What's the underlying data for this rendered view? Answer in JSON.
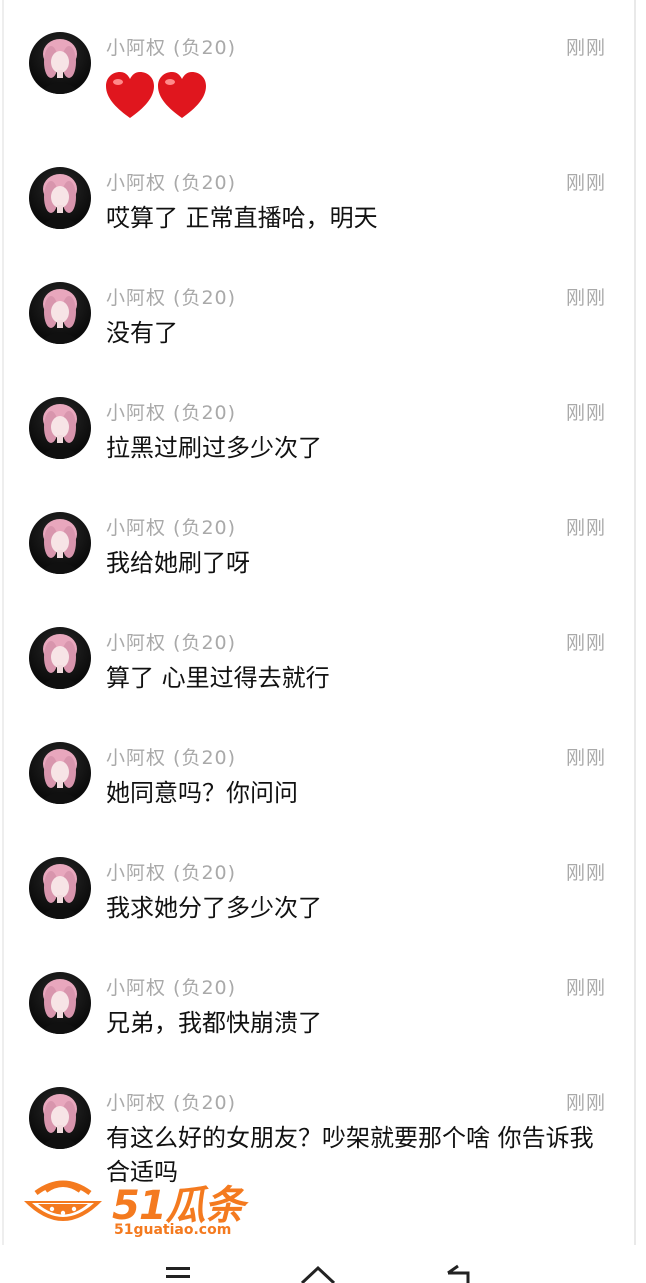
{
  "chat": {
    "messages": [
      {
        "sender": "小阿权 (负20)",
        "time": "刚刚",
        "text": "",
        "type": "hearts"
      },
      {
        "sender": "小阿权 (负20)",
        "time": "刚刚",
        "text": "哎算了 正常直播哈，明天"
      },
      {
        "sender": "小阿权 (负20)",
        "time": "刚刚",
        "text": "没有了"
      },
      {
        "sender": "小阿权 (负20)",
        "time": "刚刚",
        "text": "拉黑过刷过多少次了"
      },
      {
        "sender": "小阿权 (负20)",
        "time": "刚刚",
        "text": "我给她刷了呀"
      },
      {
        "sender": "小阿权 (负20)",
        "time": "刚刚",
        "text": "算了 心里过得去就行"
      },
      {
        "sender": "小阿权 (负20)",
        "time": "刚刚",
        "text": "她同意吗？你问问"
      },
      {
        "sender": "小阿权 (负20)",
        "time": "刚刚",
        "text": "我求她分了多少次了"
      },
      {
        "sender": "小阿权 (负20)",
        "time": "刚刚",
        "text": "兄弟，我都快崩溃了"
      },
      {
        "sender": "小阿权 (负20)",
        "time": "刚刚",
        "text": "有这么好的女朋友？吵架就要那个啥 你告诉我合适吗"
      }
    ]
  },
  "watermark": {
    "brand": "51瓜条",
    "url": "51guatiao.com",
    "color": "#f47a1f"
  },
  "nav": {
    "menu_icon": "menu-icon",
    "home_icon": "home-icon",
    "back_icon": "back-icon"
  },
  "colors": {
    "meta_text": "#a9a9a9",
    "message_text": "#111111",
    "heart": "#e0161e"
  }
}
